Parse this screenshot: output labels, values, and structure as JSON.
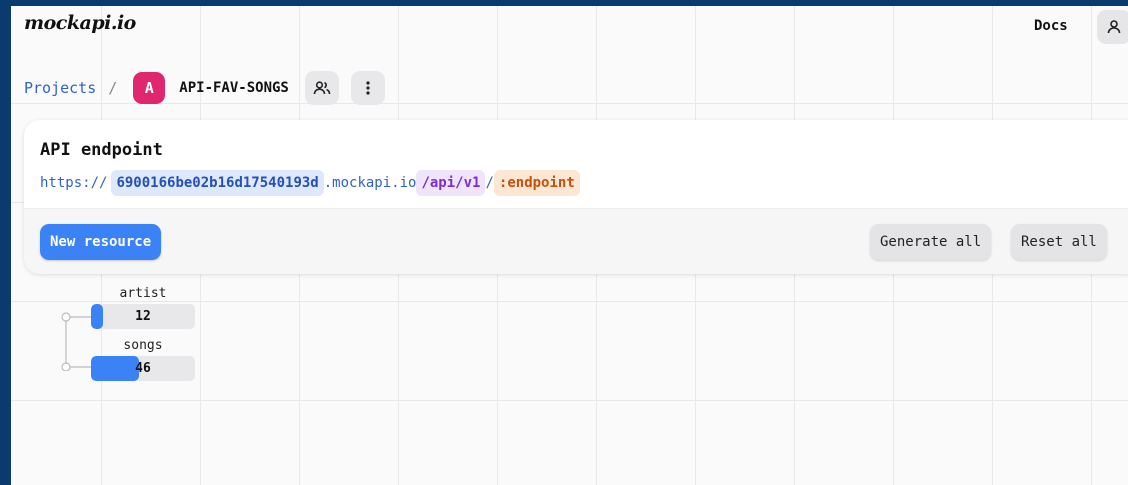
{
  "header": {
    "logo": "mockapi.io",
    "docs_label": "Docs",
    "user_icon": "user-icon"
  },
  "breadcrumb": {
    "projects_label": "Projects",
    "separator": "/",
    "project_initial": "A",
    "project_name": "API-FAV-SONGS",
    "project_color": "#e0266f",
    "team_icon": "users-icon",
    "menu_icon": "more-vertical-icon"
  },
  "card": {
    "title": "API endpoint",
    "endpoint": {
      "scheme": "https://",
      "project_id": "6900166be02b16d17540193d",
      "domain": ".mockapi.io",
      "prefix": "/api/v1",
      "slash": "/",
      "placeholder": ":endpoint"
    },
    "new_resource_label": "New resource",
    "generate_all_label": "Generate all",
    "reset_all_label": "Reset all"
  },
  "resources": [
    {
      "name": "artist",
      "count": "12",
      "fill_fraction": 0.12
    },
    {
      "name": "songs",
      "count": "46",
      "fill_fraction": 0.46
    }
  ],
  "colors": {
    "accent": "#3b82f6",
    "link": "#2e64c9",
    "background": "#0b3a6e"
  }
}
